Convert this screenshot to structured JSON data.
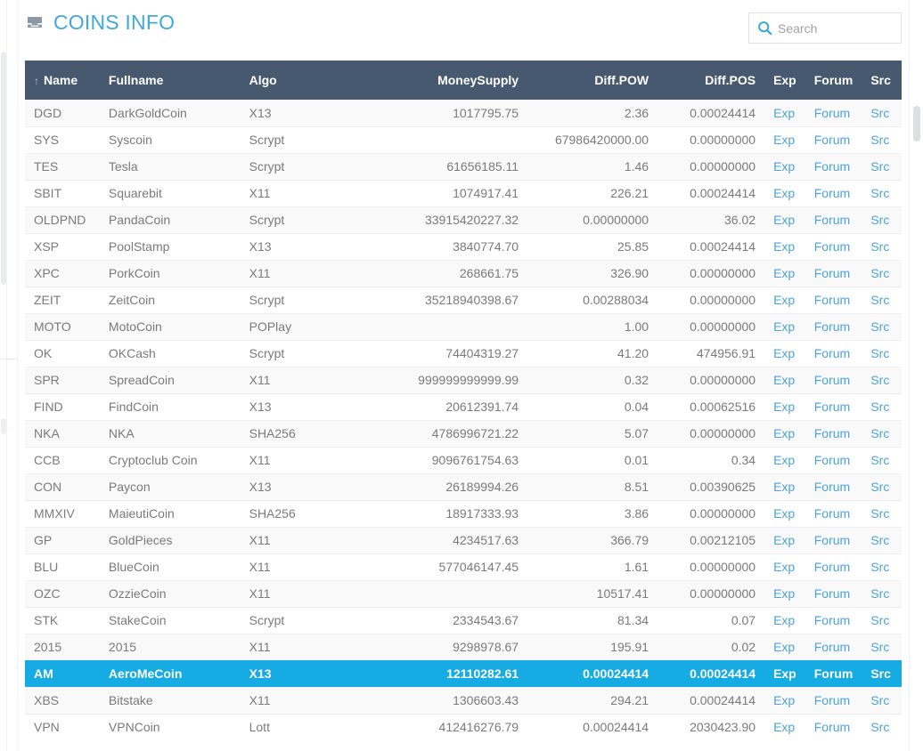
{
  "header": {
    "title": "COINS INFO",
    "title_icon": "inbox-icon",
    "accent_color": "#3fa9dd"
  },
  "search": {
    "icon": "search-icon",
    "placeholder": "Search",
    "value": ""
  },
  "table": {
    "sort_indicator": "↑",
    "sorted_column": "Name",
    "header_bg": "#47596f",
    "selected_row_bg": "#16ace3",
    "columns": [
      {
        "key": "name",
        "label": "Name"
      },
      {
        "key": "fullname",
        "label": "Fullname"
      },
      {
        "key": "algo",
        "label": "Algo"
      },
      {
        "key": "supply",
        "label": "MoneySupply"
      },
      {
        "key": "dpow",
        "label": "Diff.POW"
      },
      {
        "key": "dpos",
        "label": "Diff.POS"
      },
      {
        "key": "exp",
        "label": "Exp"
      },
      {
        "key": "forum",
        "label": "Forum"
      },
      {
        "key": "src",
        "label": "Src"
      }
    ],
    "link_labels": {
      "exp": "Exp",
      "forum": "Forum",
      "src": "Src"
    },
    "rows": [
      {
        "name": "DGD",
        "fullname": "DarkGoldCoin",
        "algo": "X13",
        "supply": "1017795.75",
        "dpow": "2.36",
        "dpos": "0.00024414",
        "selected": false
      },
      {
        "name": "SYS",
        "fullname": "Syscoin",
        "algo": "Scrypt",
        "supply": "",
        "dpow": "67986420000.00",
        "dpos": "0.00000000",
        "selected": false
      },
      {
        "name": "TES",
        "fullname": "Tesla",
        "algo": "Scrypt",
        "supply": "61656185.11",
        "dpow": "1.46",
        "dpos": "0.00000000",
        "selected": false
      },
      {
        "name": "SBIT",
        "fullname": "Squarebit",
        "algo": "X11",
        "supply": "1074917.41",
        "dpow": "226.21",
        "dpos": "0.00024414",
        "selected": false
      },
      {
        "name": "OLDPND",
        "fullname": "PandaCoin",
        "algo": "Scrypt",
        "supply": "33915420227.32",
        "dpow": "0.00000000",
        "dpos": "36.02",
        "selected": false
      },
      {
        "name": "XSP",
        "fullname": "PoolStamp",
        "algo": "X13",
        "supply": "3840774.70",
        "dpow": "25.85",
        "dpos": "0.00024414",
        "selected": false
      },
      {
        "name": "XPC",
        "fullname": "PorkCoin",
        "algo": "X11",
        "supply": "268661.75",
        "dpow": "326.90",
        "dpos": "0.00000000",
        "selected": false
      },
      {
        "name": "ZEIT",
        "fullname": "ZeitCoin",
        "algo": "Scrypt",
        "supply": "35218940398.67",
        "dpow": "0.00288034",
        "dpos": "0.00000000",
        "selected": false
      },
      {
        "name": "MOTO",
        "fullname": "MotoCoin",
        "algo": "POPlay",
        "supply": "",
        "dpow": "1.00",
        "dpos": "0.00000000",
        "selected": false
      },
      {
        "name": "OK",
        "fullname": "OKCash",
        "algo": "Scrypt",
        "supply": "74404319.27",
        "dpow": "41.20",
        "dpos": "474956.91",
        "selected": false
      },
      {
        "name": "SPR",
        "fullname": "SpreadCoin",
        "algo": "X11",
        "supply": "999999999999.99",
        "dpow": "0.32",
        "dpos": "0.00000000",
        "selected": false
      },
      {
        "name": "FIND",
        "fullname": "FindCoin",
        "algo": "X13",
        "supply": "20612391.74",
        "dpow": "0.04",
        "dpos": "0.00062516",
        "selected": false
      },
      {
        "name": "NKA",
        "fullname": "NKA",
        "algo": "SHA256",
        "supply": "4786996721.22",
        "dpow": "5.07",
        "dpos": "0.00000000",
        "selected": false
      },
      {
        "name": "CCB",
        "fullname": "Cryptoclub Coin",
        "algo": "X11",
        "supply": "9096761754.63",
        "dpow": "0.01",
        "dpos": "0.34",
        "selected": false
      },
      {
        "name": "CON",
        "fullname": "Paycon",
        "algo": "X13",
        "supply": "26189994.26",
        "dpow": "8.51",
        "dpos": "0.00390625",
        "selected": false
      },
      {
        "name": "MMXIV",
        "fullname": "MaieutiCoin",
        "algo": "SHA256",
        "supply": "18917333.93",
        "dpow": "3.86",
        "dpos": "0.00000000",
        "selected": false
      },
      {
        "name": "GP",
        "fullname": "GoldPieces",
        "algo": "X11",
        "supply": "4234517.63",
        "dpow": "366.79",
        "dpos": "0.00212105",
        "selected": false
      },
      {
        "name": "BLU",
        "fullname": "BlueCoin",
        "algo": "X11",
        "supply": "577046147.45",
        "dpow": "1.61",
        "dpos": "0.00000000",
        "selected": false
      },
      {
        "name": "OZC",
        "fullname": "OzzieCoin",
        "algo": "X11",
        "supply": "",
        "dpow": "10517.41",
        "dpos": "0.00000000",
        "selected": false
      },
      {
        "name": "STK",
        "fullname": "StakeCoin",
        "algo": "Scrypt",
        "supply": "2334543.67",
        "dpow": "81.34",
        "dpos": "0.07",
        "selected": false
      },
      {
        "name": "2015",
        "fullname": "2015",
        "algo": "X11",
        "supply": "9298978.67",
        "dpow": "195.91",
        "dpos": "0.02",
        "selected": false
      },
      {
        "name": "AM",
        "fullname": "AeroMeCoin",
        "algo": "X13",
        "supply": "12110282.61",
        "dpow": "0.00024414",
        "dpos": "0.00024414",
        "selected": true
      },
      {
        "name": "XBS",
        "fullname": "Bitstake",
        "algo": "X11",
        "supply": "1306603.43",
        "dpow": "294.21",
        "dpos": "0.00024414",
        "selected": false
      },
      {
        "name": "VPN",
        "fullname": "VPNCoin",
        "algo": "Lott",
        "supply": "412416276.79",
        "dpow": "0.00024414",
        "dpos": "2030423.90",
        "selected": false
      }
    ]
  }
}
